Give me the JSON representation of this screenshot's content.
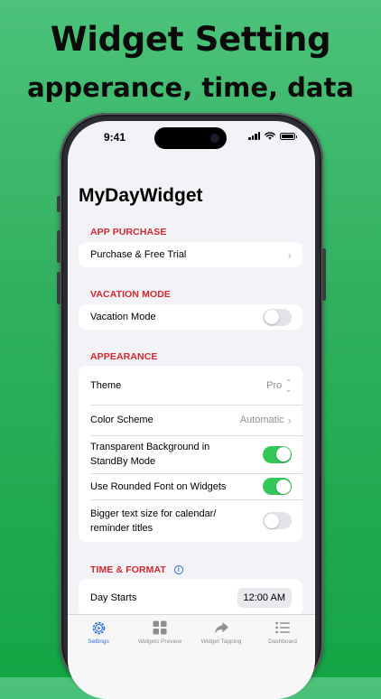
{
  "promo": {
    "title": "Widget Setting",
    "subtitle": "apperance, time, data"
  },
  "status_bar": {
    "time": "9:41"
  },
  "app": {
    "title": "MyDayWidget"
  },
  "sections": {
    "app_purchase": {
      "header": "APP PURCHASE",
      "purchase_label": "Purchase & Free Trial"
    },
    "vacation": {
      "header": "VACATION MODE",
      "vacation_label": "Vacation Mode",
      "vacation_on": false
    },
    "appearance": {
      "header": "APPEARANCE",
      "theme_label": "Theme",
      "theme_value": "Pro",
      "color_scheme_label": "Color Scheme",
      "color_scheme_value": "Automatic",
      "transparent_label": "Transparent Background in StandBy Mode",
      "transparent_on": true,
      "rounded_label": "Use Rounded Font on Widgets",
      "rounded_on": true,
      "bigger_label": "Bigger text size for calendar/ reminder titles",
      "bigger_on": false
    },
    "time_format": {
      "header": "TIME & FORMAT",
      "day_starts_label": "Day Starts",
      "day_starts_value": "12:00 AM"
    }
  },
  "tabs": [
    {
      "label": "Settings",
      "icon": "settings-gear-icon",
      "active": true
    },
    {
      "label": "Widgets Preview",
      "icon": "grid-icon",
      "active": false
    },
    {
      "label": "Widget Tapping",
      "icon": "share-arrow-icon",
      "active": false
    },
    {
      "label": "Dashboard",
      "icon": "list-icon",
      "active": false
    }
  ],
  "colors": {
    "accent": "#2f6fd6",
    "section_header": "#d3282f",
    "toggle_on": "#34c759",
    "background_green": "#2fb05d"
  }
}
